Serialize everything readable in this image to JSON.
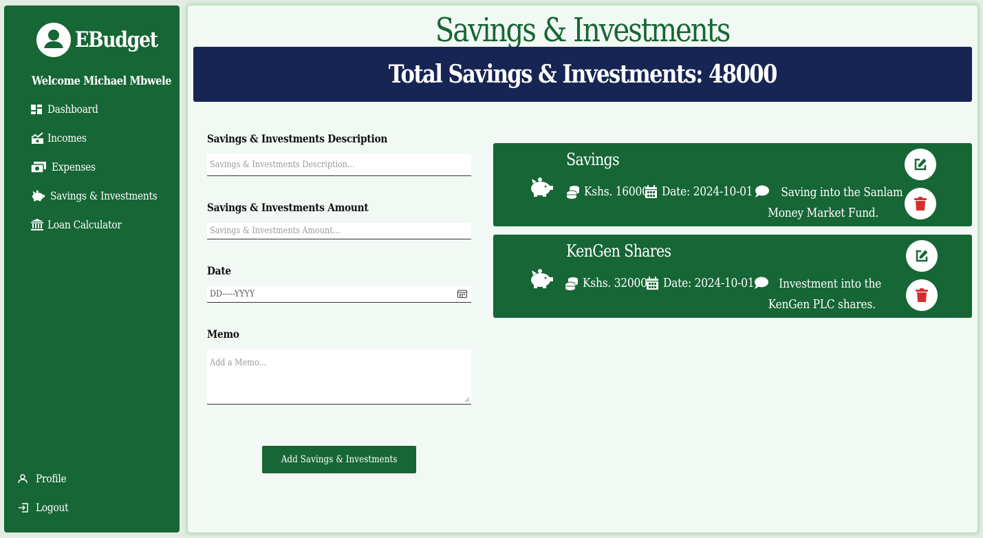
{
  "sidebar": {
    "brand": "EBudget",
    "welcome": "Welcome Michael Mbwele",
    "items": [
      {
        "label": "Dashboard",
        "icon": "dashboard-icon"
      },
      {
        "label": "Incomes",
        "icon": "incomes-chart-icon"
      },
      {
        "label": "Expenses",
        "icon": "money-bill-icon"
      },
      {
        "label": "Savings & Investments",
        "icon": "piggy-bank-icon"
      },
      {
        "label": "Loan Calculator",
        "icon": "bank-building-icon"
      }
    ],
    "profile": "Profile",
    "logout": "Logout"
  },
  "main": {
    "title": "Savings & Investments",
    "total": "Total Savings & Investments: 48000"
  },
  "form": {
    "description_label": "Savings & Investments Description",
    "description_placeholder": "Savings & Investments Description...",
    "description_value": "",
    "amount_label": "Savings & Investments Amount",
    "amount_placeholder": "Savings & Investments Amount...",
    "amount_value": "",
    "date_label": "Date",
    "date_placeholder": "DD-----YYYY",
    "memo_label": "Memo",
    "memo_placeholder": "Add a Memo...",
    "submit_label": "Add Savings & Investments"
  },
  "entries": [
    {
      "title": "Savings",
      "amount": "Kshs. 16000",
      "date": "Date: 2024-10-01",
      "memo_line1": "Saving into the Sanlam",
      "memo_line2": "Money Market Fund."
    },
    {
      "title": "KenGen Shares",
      "amount": "Kshs. 32000",
      "date": "Date: 2024-10-01",
      "memo_line1": "Investment into the",
      "memo_line2": "KenGen PLC shares."
    }
  ],
  "colors": {
    "sidebar": "#176635",
    "banner": "#172554",
    "panel": "#f2f9f4",
    "edit_icon": "#176635",
    "delete_icon": "#d32f2f"
  }
}
